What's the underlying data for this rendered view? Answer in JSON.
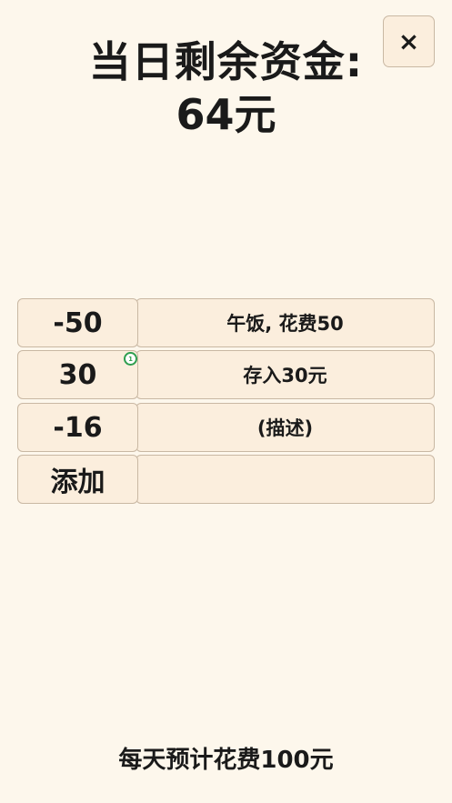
{
  "header": {
    "title": "当日剩余资金:",
    "amount": "64元",
    "close_label": "×"
  },
  "entries": [
    {
      "amount": "-50",
      "description": "午饭, 花费50"
    },
    {
      "amount": "30",
      "description": "存入30元",
      "badge": "1"
    },
    {
      "amount": "-16",
      "description": "(描述)"
    }
  ],
  "add_row": {
    "label": "添加",
    "description": ""
  },
  "footer": {
    "daily_budget_text": "每天预计花费100元"
  },
  "colors": {
    "background": "#fdf7ec",
    "cell": "#fbeedd",
    "border": "#c9b8a3",
    "badge": "#2e9e4f"
  }
}
